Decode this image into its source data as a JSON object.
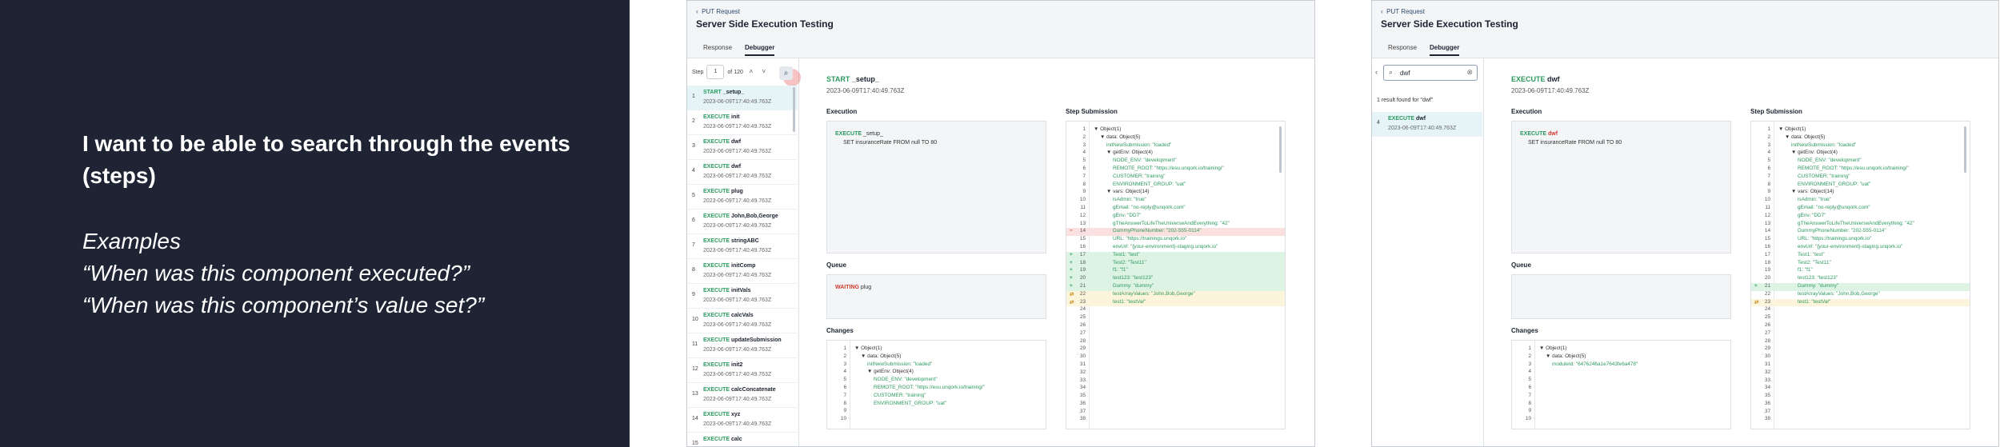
{
  "intro": {
    "heading": "I want to be able to search through the events (steps)",
    "examples_label": "Examples",
    "example_1": "“When was this component executed?”",
    "example_2": "“When was this component’s value set?”"
  },
  "common": {
    "breadcrumb": "PUT Request",
    "title": "Server Side Execution Testing",
    "tab_response": "Response",
    "tab_debugger": "Debugger",
    "execution_label": "Execution",
    "queue_label": "Queue",
    "changes_label": "Changes",
    "step_submission_label": "Step Submission"
  },
  "window1": {
    "step_label": "Step",
    "step_value": "1",
    "step_of": "of 120",
    "events": [
      {
        "num": "1",
        "kw": "START",
        "name": "_setup_",
        "date": "2023-06-09T17:40:49.763Z"
      },
      {
        "num": "2",
        "kw": "EXECUTE",
        "name": "init",
        "date": "2023-06-09T17:40:49.763Z"
      },
      {
        "num": "3",
        "kw": "EXECUTE",
        "name": "dwf",
        "date": "2023-06-09T17:40:49.763Z"
      },
      {
        "num": "4",
        "kw": "EXECUTE",
        "name": "dwf",
        "date": "2023-06-09T17:40:49.763Z"
      },
      {
        "num": "5",
        "kw": "EXECUTE",
        "name": "plug",
        "date": "2023-06-09T17:40:49.763Z"
      },
      {
        "num": "6",
        "kw": "EXECUTE",
        "name": "John,Bob,George",
        "date": "2023-06-09T17:40:49.763Z"
      },
      {
        "num": "7",
        "kw": "EXECUTE",
        "name": "stringABC",
        "date": "2023-06-09T17:40:49.763Z"
      },
      {
        "num": "8",
        "kw": "EXECUTE",
        "name": "initComp",
        "date": "2023-06-09T17:40:49.763Z"
      },
      {
        "num": "9",
        "kw": "EXECUTE",
        "name": "initVals",
        "date": "2023-06-09T17:40:49.763Z"
      },
      {
        "num": "10",
        "kw": "EXECUTE",
        "name": "calcVals",
        "date": "2023-06-09T17:40:49.763Z"
      },
      {
        "num": "11",
        "kw": "EXECUTE",
        "name": "updateSubmission",
        "date": "2023-06-09T17:40:49.763Z"
      },
      {
        "num": "12",
        "kw": "EXECUTE",
        "name": "init2",
        "date": "2023-06-09T17:40:49.763Z"
      },
      {
        "num": "13",
        "kw": "EXECUTE",
        "name": "calcConcatenate",
        "date": "2023-06-09T17:40:49.763Z"
      },
      {
        "num": "14",
        "kw": "EXECUTE",
        "name": "xyz",
        "date": "2023-06-09T17:40:49.763Z"
      },
      {
        "num": "15",
        "kw": "EXECUTE",
        "name": "calc",
        "date": ""
      }
    ],
    "detail_kw": "START",
    "detail_name": "_setup_",
    "detail_date": "2023-06-09T17:40:49.763Z",
    "exec_kw": "EXECUTE",
    "exec_name": "_setup_",
    "exec_line2": "SET insuranceRate FROM null TO 80",
    "queue_kw": "WAITING",
    "queue_name": "plug",
    "changes": [
      {
        "n": "1",
        "g": "",
        "t": "▼ Object(1)",
        "cls": "",
        "ind": 0
      },
      {
        "n": "2",
        "g": "",
        "t": "▼ data: Object(5)",
        "cls": "",
        "ind": 1
      },
      {
        "n": "3",
        "g": "",
        "t": "initNewSubmission: \"loaded\"",
        "cls": "",
        "ind": 2
      },
      {
        "n": "4",
        "g": "",
        "t": "▼ getEnv: Object(4)",
        "cls": "",
        "ind": 2
      },
      {
        "n": "5",
        "g": "",
        "t": "NODE_ENV: \"development\"",
        "cls": "",
        "ind": 3
      },
      {
        "n": "6",
        "g": "",
        "t": "REMOTE_ROOT: \"https://esu.unqork.io/training/\"",
        "cls": "",
        "ind": 3
      },
      {
        "n": "7",
        "g": "",
        "t": "CUSTOMER: \"training\"",
        "cls": "",
        "ind": 3
      },
      {
        "n": "8",
        "g": "",
        "t": "ENVIRONMENT_GROUP: \"uat\"",
        "cls": "",
        "ind": 3
      },
      {
        "n": "9",
        "g": "",
        "t": "",
        "cls": "",
        "ind": 0
      },
      {
        "n": "10",
        "g": "",
        "t": "",
        "cls": "",
        "ind": 0
      }
    ],
    "submission": [
      {
        "n": "1",
        "g": "",
        "t": "▼ Object(1)",
        "cls": "",
        "ind": 0
      },
      {
        "n": "2",
        "g": "",
        "t": "▼ data: Object(5)",
        "cls": "",
        "ind": 1
      },
      {
        "n": "3",
        "g": "",
        "t": "initNewSubmission: \"loaded\"",
        "cls": "",
        "ind": 2
      },
      {
        "n": "4",
        "g": "",
        "t": "▼ getEnv: Object(4)",
        "cls": "",
        "ind": 2
      },
      {
        "n": "5",
        "g": "",
        "t": "NODE_ENV: \"development\"",
        "cls": "",
        "ind": 3
      },
      {
        "n": "6",
        "g": "",
        "t": "REMOTE_ROOT: \"https://esu.unqork.io/training/\"",
        "cls": "",
        "ind": 3
      },
      {
        "n": "7",
        "g": "",
        "t": "CUSTOMER: \"training\"",
        "cls": "",
        "ind": 3
      },
      {
        "n": "8",
        "g": "",
        "t": "ENVIRONMENT_GROUP: \"uat\"",
        "cls": "",
        "ind": 3
      },
      {
        "n": "9",
        "g": "",
        "t": "▼ vars: Object(14)",
        "cls": "",
        "ind": 2
      },
      {
        "n": "10",
        "g": "",
        "t": "isAdmin: \"true\"",
        "cls": "",
        "ind": 3
      },
      {
        "n": "11",
        "g": "",
        "t": "gEmail: \"no-reply@unqork.com\"",
        "cls": "",
        "ind": 3
      },
      {
        "n": "12",
        "g": "",
        "t": "gEnv: \"DD7\"",
        "cls": "",
        "ind": 3
      },
      {
        "n": "13",
        "g": "",
        "t": "gTheAnswerToLifeTheUniverseAndEverything: \"42\"",
        "cls": "",
        "ind": 3
      },
      {
        "n": "14",
        "g": "−",
        "t": "DummyPhoneNumber: \"202-555-0114\"",
        "cls": "del",
        "ind": 3
      },
      {
        "n": "15",
        "g": "",
        "t": "URL: \"https://trainings.unqork.io\"",
        "cls": "",
        "ind": 3
      },
      {
        "n": "16",
        "g": "",
        "t": "envUrl: \"{your-environment}-staging.unqork.io\"",
        "cls": "",
        "ind": 3
      },
      {
        "n": "17",
        "g": "+",
        "t": "Test1: \"test\"",
        "cls": "add",
        "ind": 3
      },
      {
        "n": "18",
        "g": "+",
        "t": "Test2: \"Test11\"",
        "cls": "add",
        "ind": 3
      },
      {
        "n": "19",
        "g": "+",
        "t": "f1: \"f1\"",
        "cls": "add",
        "ind": 3
      },
      {
        "n": "20",
        "g": "+",
        "t": "test123: \"test123\"",
        "cls": "add",
        "ind": 3
      },
      {
        "n": "21",
        "g": "+",
        "t": "Dummy: \"dummy\"",
        "cls": "add",
        "ind": 3
      },
      {
        "n": "22",
        "g": "⇄",
        "t": "testArrayValues: \"John,Bob,George\"",
        "cls": "mod",
        "ind": 3
      },
      {
        "n": "23",
        "g": "⇄",
        "t": "test1: \"testVal\"",
        "cls": "mod",
        "ind": 3
      },
      {
        "n": "24",
        "g": "",
        "t": "",
        "cls": "",
        "ind": 0
      },
      {
        "n": "25",
        "g": "",
        "t": "",
        "cls": "",
        "ind": 0
      },
      {
        "n": "26",
        "g": "",
        "t": "",
        "cls": "",
        "ind": 0
      },
      {
        "n": "27",
        "g": "",
        "t": "",
        "cls": "",
        "ind": 0
      },
      {
        "n": "28",
        "g": "",
        "t": "",
        "cls": "",
        "ind": 0
      },
      {
        "n": "29",
        "g": "",
        "t": "",
        "cls": "",
        "ind": 0
      },
      {
        "n": "30",
        "g": "",
        "t": "",
        "cls": "",
        "ind": 0
      },
      {
        "n": "31",
        "g": "",
        "t": "",
        "cls": "",
        "ind": 0
      },
      {
        "n": "32",
        "g": "",
        "t": "",
        "cls": "",
        "ind": 0
      },
      {
        "n": "33",
        "g": "",
        "t": "",
        "cls": "",
        "ind": 0
      },
      {
        "n": "34",
        "g": "",
        "t": "",
        "cls": "",
        "ind": 0
      },
      {
        "n": "35",
        "g": "",
        "t": "",
        "cls": "",
        "ind": 0
      },
      {
        "n": "36",
        "g": "",
        "t": "",
        "cls": "",
        "ind": 0
      },
      {
        "n": "37",
        "g": "",
        "t": "",
        "cls": "",
        "ind": 0
      },
      {
        "n": "38",
        "g": "",
        "t": "",
        "cls": "",
        "ind": 0
      }
    ]
  },
  "window2": {
    "search_value": "dwf",
    "result_text": "1 result found for \"dwf\"",
    "events": [
      {
        "num": "4",
        "kw": "EXECUTE",
        "name": "dwf",
        "date": "2023-06-09T17:40:49.763Z"
      }
    ],
    "detail_kw": "EXECUTE",
    "detail_name": "dwf",
    "detail_date": "2023-06-09T17:40:49.763Z",
    "exec_kw": "EXECUTE",
    "exec_name": "dwf",
    "exec_line2": "SET insuranceRate FROM null TO 80",
    "changes": [
      {
        "n": "1",
        "g": "",
        "t": "▼ Object(1)",
        "cls": "",
        "ind": 0
      },
      {
        "n": "2",
        "g": "",
        "t": "▼ data: Object(5)",
        "cls": "",
        "ind": 1
      },
      {
        "n": "3",
        "g": "",
        "t": "moduleId: \"6476246a1e7643fe6a478\"",
        "cls": "",
        "ind": 2
      },
      {
        "n": "4",
        "g": "",
        "t": "",
        "cls": "",
        "ind": 0
      },
      {
        "n": "5",
        "g": "",
        "t": "",
        "cls": "",
        "ind": 0
      },
      {
        "n": "6",
        "g": "",
        "t": "",
        "cls": "",
        "ind": 0
      },
      {
        "n": "7",
        "g": "",
        "t": "",
        "cls": "",
        "ind": 0
      },
      {
        "n": "8",
        "g": "",
        "t": "",
        "cls": "",
        "ind": 0
      },
      {
        "n": "9",
        "g": "",
        "t": "",
        "cls": "",
        "ind": 0
      },
      {
        "n": "10",
        "g": "",
        "t": "",
        "cls": "",
        "ind": 0
      }
    ],
    "submission": [
      {
        "n": "1",
        "g": "",
        "t": "▼ Object(1)",
        "cls": "",
        "ind": 0
      },
      {
        "n": "2",
        "g": "",
        "t": "▼ data: Object(5)",
        "cls": "",
        "ind": 1
      },
      {
        "n": "3",
        "g": "",
        "t": "initNewSubmission: \"loaded\"",
        "cls": "",
        "ind": 2
      },
      {
        "n": "4",
        "g": "",
        "t": "▼ getEnv: Object(4)",
        "cls": "",
        "ind": 2
      },
      {
        "n": "5",
        "g": "",
        "t": "NODE_ENV: \"development\"",
        "cls": "",
        "ind": 3
      },
      {
        "n": "6",
        "g": "",
        "t": "REMOTE_ROOT: \"https://esu.unqork.io/training/\"",
        "cls": "",
        "ind": 3
      },
      {
        "n": "7",
        "g": "",
        "t": "CUSTOMER: \"training\"",
        "cls": "",
        "ind": 3
      },
      {
        "n": "8",
        "g": "",
        "t": "ENVIRONMENT_GROUP: \"uat\"",
        "cls": "",
        "ind": 3
      },
      {
        "n": "9",
        "g": "",
        "t": "▼ vars: Object(14)",
        "cls": "",
        "ind": 2
      },
      {
        "n": "10",
        "g": "",
        "t": "isAdmin: \"true\"",
        "cls": "",
        "ind": 3
      },
      {
        "n": "11",
        "g": "",
        "t": "gEmail: \"no-reply@unqork.com\"",
        "cls": "",
        "ind": 3
      },
      {
        "n": "12",
        "g": "",
        "t": "gEnv: \"DD7\"",
        "cls": "",
        "ind": 3
      },
      {
        "n": "13",
        "g": "",
        "t": "gTheAnswerToLifeTheUniverseAndEverything: \"42\"",
        "cls": "",
        "ind": 3
      },
      {
        "n": "14",
        "g": "",
        "t": "DummyPhoneNumber: \"202-555-0114\"",
        "cls": "",
        "ind": 3
      },
      {
        "n": "15",
        "g": "",
        "t": "URL: \"https://trainings.unqork.io\"",
        "cls": "",
        "ind": 3
      },
      {
        "n": "16",
        "g": "",
        "t": "envUrl: \"{your-environment}-staging.unqork.io\"",
        "cls": "",
        "ind": 3
      },
      {
        "n": "17",
        "g": "",
        "t": "Test1: \"test\"",
        "cls": "",
        "ind": 3
      },
      {
        "n": "18",
        "g": "",
        "t": "Test2: \"Test11\"",
        "cls": "",
        "ind": 3
      },
      {
        "n": "19",
        "g": "",
        "t": "f1: \"f1\"",
        "cls": "",
        "ind": 3
      },
      {
        "n": "20",
        "g": "",
        "t": "test123: \"test123\"",
        "cls": "",
        "ind": 3
      },
      {
        "n": "21",
        "g": "+",
        "t": "Dummy: \"dummy\"",
        "cls": "add",
        "ind": 3
      },
      {
        "n": "22",
        "g": "",
        "t": "testArrayValues: \"John,Bob,George\"",
        "cls": "",
        "ind": 3
      },
      {
        "n": "23",
        "g": "⇄",
        "t": "test1: \"testVal\"",
        "cls": "mod",
        "ind": 3
      },
      {
        "n": "24",
        "g": "",
        "t": "",
        "cls": "",
        "ind": 0
      },
      {
        "n": "25",
        "g": "",
        "t": "",
        "cls": "",
        "ind": 0
      },
      {
        "n": "26",
        "g": "",
        "t": "",
        "cls": "",
        "ind": 0
      },
      {
        "n": "27",
        "g": "",
        "t": "",
        "cls": "",
        "ind": 0
      },
      {
        "n": "28",
        "g": "",
        "t": "",
        "cls": "",
        "ind": 0
      },
      {
        "n": "29",
        "g": "",
        "t": "",
        "cls": "",
        "ind": 0
      },
      {
        "n": "30",
        "g": "",
        "t": "",
        "cls": "",
        "ind": 0
      },
      {
        "n": "31",
        "g": "",
        "t": "",
        "cls": "",
        "ind": 0
      },
      {
        "n": "32",
        "g": "",
        "t": "",
        "cls": "",
        "ind": 0
      },
      {
        "n": "33",
        "g": "",
        "t": "",
        "cls": "",
        "ind": 0
      },
      {
        "n": "34",
        "g": "",
        "t": "",
        "cls": "",
        "ind": 0
      },
      {
        "n": "35",
        "g": "",
        "t": "",
        "cls": "",
        "ind": 0
      },
      {
        "n": "36",
        "g": "",
        "t": "",
        "cls": "",
        "ind": 0
      },
      {
        "n": "37",
        "g": "",
        "t": "",
        "cls": "",
        "ind": 0
      },
      {
        "n": "38",
        "g": "",
        "t": "",
        "cls": "",
        "ind": 0
      }
    ]
  }
}
